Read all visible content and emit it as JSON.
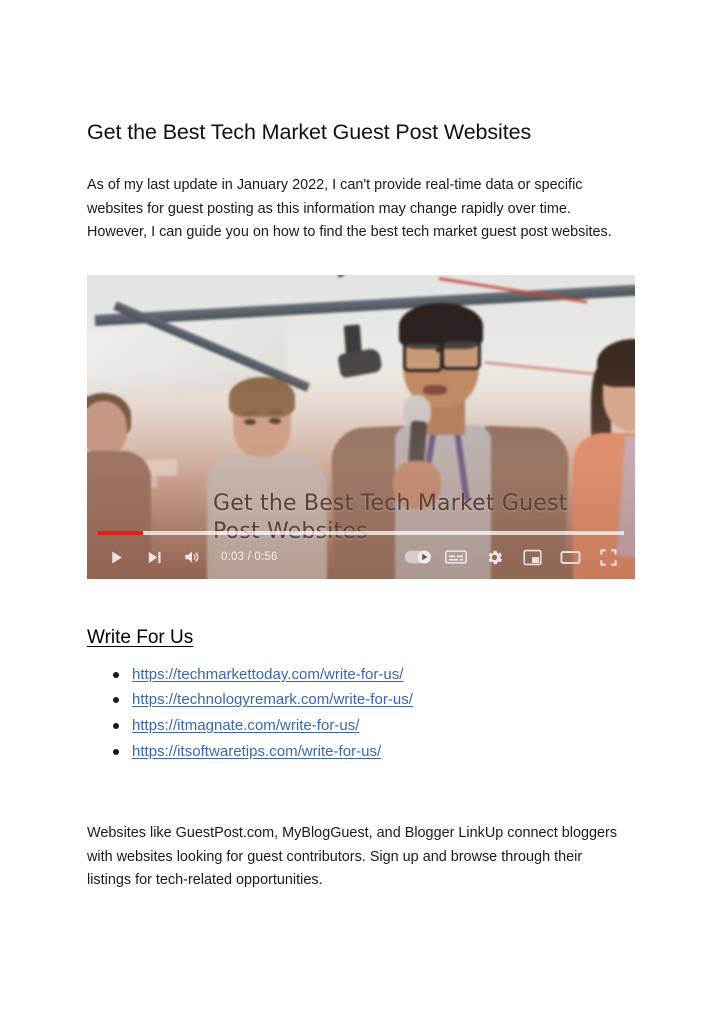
{
  "document": {
    "title": "Get the Best Tech Market Guest Post Websites",
    "intro_paragraph": "As of my last update in January 2022, I can't provide real-time data or specific websites for guest posting as this information may change rapidly over time. However, I can guide you on how to find the best tech market guest post websites.",
    "section_heading": "Write For Us",
    "outro_paragraph": "Websites like GuestPost.com, MyBlogGuest, and Blogger LinkUp connect bloggers with websites looking for guest contributors. Sign up and browse through their listings for tech-related opportunities.",
    "links": [
      {
        "text": "https://techmarkettoday.com/write-for-us/"
      },
      {
        "text": "https://technologyremark.com/write-for-us/"
      },
      {
        "text": "https://itmagnate.com/write-for-us/"
      },
      {
        "text": "https://itsoftwaretips.com/write-for-us/"
      }
    ]
  },
  "video": {
    "overlay_caption": "Get the Best Tech Market Guest Post Websites",
    "scene_description": "Man in a blazer speaking into a microphone at a conference panel under a white tent with dark ceiling beams; people seated around him",
    "controls": {
      "play_label": "Play",
      "next_label": "Next",
      "volume_label": "Mute",
      "time_display": "0:03 / 0:56",
      "current_time": "0:03",
      "duration": "0:56",
      "autoplay_label": "Autoplay",
      "autoplay_state": "on",
      "subtitles_label": "Subtitles/closed captions",
      "settings_label": "Settings",
      "miniplayer_label": "Miniplayer",
      "theater_label": "Theater mode",
      "fullscreen_label": "Full screen"
    },
    "progress_percent": 8.6,
    "colors": {
      "progress_played": "#e0201a",
      "progress_track": "#ffffffb8"
    }
  },
  "colors": {
    "page_background": "#ffffff",
    "body_text": "#1a1a1a",
    "title_text": "#101010",
    "link": "#3a66b0",
    "bullet": "#1a1a1a"
  }
}
